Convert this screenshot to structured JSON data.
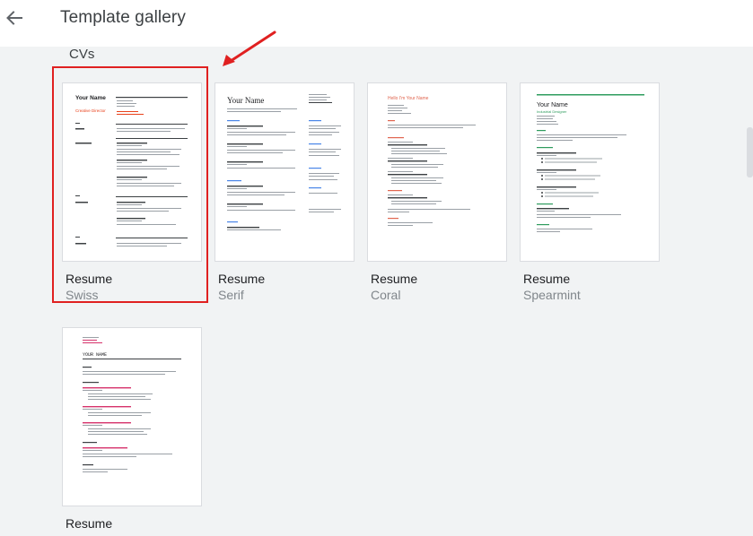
{
  "header": {
    "title": "Template gallery",
    "back_icon": "arrow-left-icon"
  },
  "section": {
    "title": "CVs"
  },
  "templates": [
    {
      "name": "Resume",
      "style": "Swiss",
      "preview_heading": "Your Name",
      "preview_subtitle": "Creative Director"
    },
    {
      "name": "Resume",
      "style": "Serif",
      "preview_heading": "Your Name"
    },
    {
      "name": "Resume",
      "style": "Coral",
      "preview_heading": "Hello I'm Your Name"
    },
    {
      "name": "Resume",
      "style": "Spearmint",
      "preview_heading": "Your Name",
      "preview_subtitle": "Industrial Designer"
    },
    {
      "name": "Resume",
      "style": "",
      "preview_heading": "YOUR NAME"
    }
  ],
  "colors": {
    "highlight": "#e02020",
    "swiss_accent": "#e8411b",
    "serif_accent": "#4a86e8",
    "coral_accent": "#e06650",
    "spearmint_accent": "#2f9c5e",
    "mono_accent": "#d6336c"
  }
}
